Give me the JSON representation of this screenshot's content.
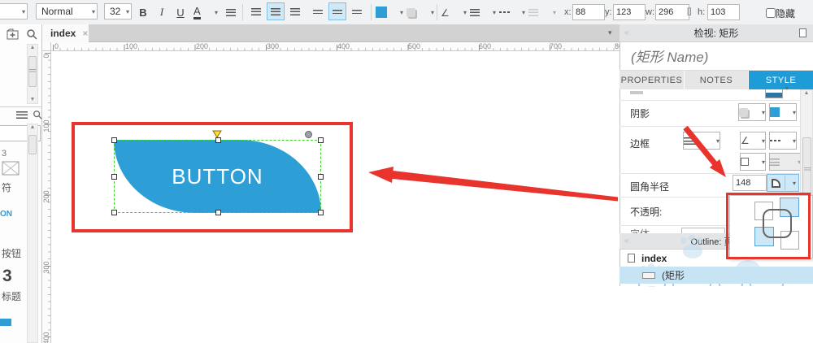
{
  "toolbar": {
    "style_dropdown": "Normal",
    "font_size": "32",
    "bold": "B",
    "italic": "I",
    "underline": "U",
    "text_color": "A",
    "x_label": "x:",
    "x_value": "88",
    "y_label": "y:",
    "y_value": "123",
    "w_label": "w:",
    "w_value": "296",
    "h_label": "h:",
    "h_value": "103",
    "hide_label": "隐藏"
  },
  "tabs": {
    "page_tab": "index",
    "close": "×"
  },
  "rulers": {
    "h": [
      "0",
      "100",
      "200",
      "300",
      "400",
      "500",
      "600",
      "700",
      "80"
    ],
    "v": [
      "0",
      "100",
      "200",
      "300",
      "400"
    ]
  },
  "canvas": {
    "button_label": "BUTTON"
  },
  "widgets_panel": {
    "fragments": [
      "3",
      "符",
      "ON",
      "按钮",
      "3",
      "标题"
    ]
  },
  "inspector": {
    "header": "检视: 矩形",
    "name_placeholder": "(矩形 Name)",
    "tab_properties": "PROPERTIES",
    "tab_notes": "NOTES",
    "tab_style": "STYLE",
    "shadow_label": "阴影",
    "border_label": "边框",
    "radius_label": "圆角半径",
    "radius_value": "148",
    "opacity_label": "不透明:",
    "font_label_partial": "字体",
    "outline_header": "Outline: 页面",
    "tree": {
      "page": "index",
      "widget": "(矩形"
    }
  },
  "colors": {
    "accent_blue": "#2e9fd6",
    "selection_green": "#3fd32a",
    "annotation_red": "#e8342c",
    "tab_active_blue": "#1e9cd7",
    "highlight_blue": "#cde9f8"
  }
}
